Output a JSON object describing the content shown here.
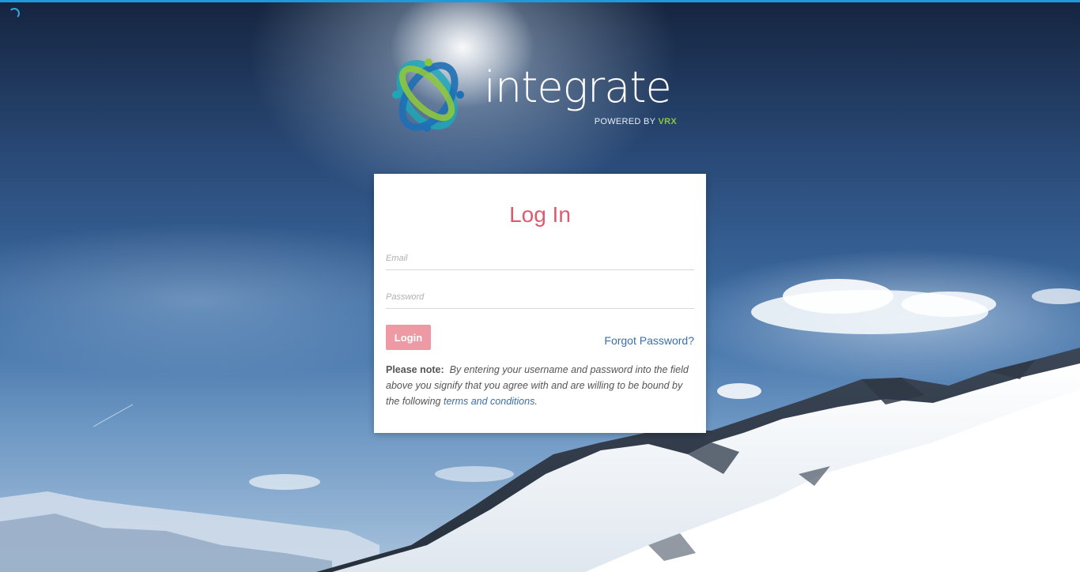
{
  "app": {
    "logo_word": "integrate",
    "powered_prefix": "POWERED BY",
    "powered_brand": "VRX"
  },
  "login": {
    "title": "Log In",
    "email_placeholder": "Email",
    "password_placeholder": "Password",
    "login_label": "Login",
    "forgot_label": "Forgot Password?",
    "note_label": "Please note:",
    "note_text": "By entering your username and password into the field above you signify that you agree with and are willing to be bound by the following",
    "terms_link": "terms and conditions",
    "note_end": "."
  },
  "colors": {
    "accent": "#e05a6d",
    "button": "#ee9aa4",
    "link": "#3a6fa8",
    "loading_bar": "#1e9ad6",
    "logo_green": "#8cc63f",
    "logo_blue": "#1f6fb5",
    "logo_teal": "#1ea7b8"
  }
}
